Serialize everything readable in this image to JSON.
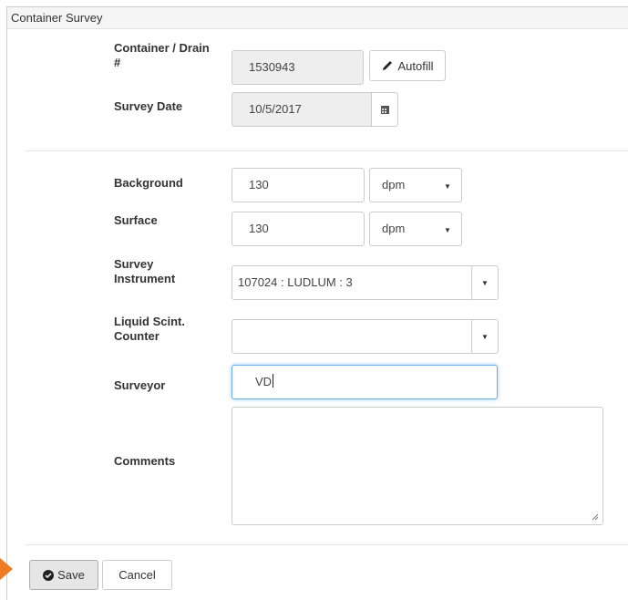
{
  "panel": {
    "title": "Container Survey"
  },
  "labels": {
    "container_line1": "Container / Drain",
    "container_line2": "#",
    "survey_date": "Survey Date",
    "background": "Background",
    "surface": "Surface",
    "survey_instrument_line1": "Survey",
    "survey_instrument_line2": "Instrument",
    "lsc_line1": "Liquid Scint.",
    "lsc_line2": "Counter",
    "surveyor": "Surveyor",
    "comments": "Comments"
  },
  "fields": {
    "container_value": "1530943",
    "autofill_label": "Autofill",
    "survey_date_value": "10/5/2017",
    "background_value": "130",
    "background_unit": "dpm",
    "surface_value": "130",
    "surface_unit": "dpm",
    "survey_instrument_value": "107024 : LUDLUM : 3",
    "lsc_value": "",
    "surveyor_value": "VD",
    "comments_value": ""
  },
  "buttons": {
    "save": "Save",
    "cancel": "Cancel"
  },
  "colors": {
    "accent_arrow": "#ee7a22",
    "focus_border": "#66afe9"
  },
  "icons": {
    "autofill": "pencil-icon",
    "calendar": "calendar-icon",
    "save": "check-circle-icon",
    "dropdown": "caret-down-icon"
  }
}
